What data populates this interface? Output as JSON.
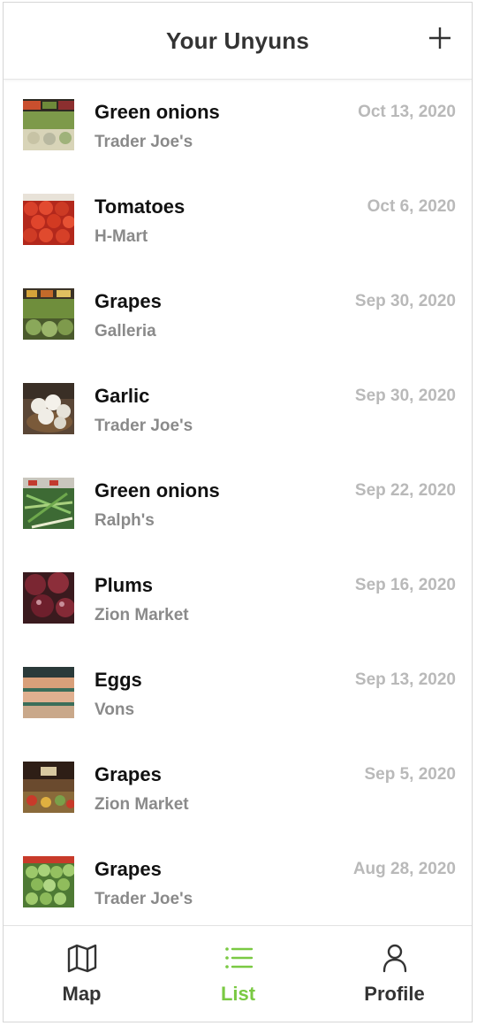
{
  "header": {
    "title": "Your Unyuns",
    "add_icon": "plus-icon"
  },
  "items": [
    {
      "name": "Green onions",
      "store": "Trader Joe's",
      "date": "Oct 13, 2020",
      "photo": "green-onions-produce-photo"
    },
    {
      "name": "Tomatoes",
      "store": "H-Mart",
      "date": "Oct 6, 2020",
      "photo": "tomatoes-photo"
    },
    {
      "name": "Grapes",
      "store": "Galleria",
      "date": "Sep 30, 2020",
      "photo": "produce-stand-photo"
    },
    {
      "name": "Garlic",
      "store": "Trader Joe's",
      "date": "Sep 30, 2020",
      "photo": "garlic-basket-photo"
    },
    {
      "name": "Green onions",
      "store": "Ralph's",
      "date": "Sep 22, 2020",
      "photo": "green-onions-shelf-photo"
    },
    {
      "name": "Plums",
      "store": "Zion Market",
      "date": "Sep 16, 2020",
      "photo": "plums-photo"
    },
    {
      "name": "Eggs",
      "store": "Vons",
      "date": "Sep 13, 2020",
      "photo": "eggs-aisle-photo"
    },
    {
      "name": "Grapes",
      "store": "Zion Market",
      "date": "Sep 5, 2020",
      "photo": "market-interior-photo"
    },
    {
      "name": "Grapes",
      "store": "Trader Joe's",
      "date": "Aug 28, 2020",
      "photo": "green-grapes-photo"
    }
  ],
  "tabs": [
    {
      "label": "Map",
      "icon": "map-icon",
      "active": false
    },
    {
      "label": "List",
      "icon": "list-icon",
      "active": true
    },
    {
      "label": "Profile",
      "icon": "person-icon",
      "active": false
    }
  ],
  "colors": {
    "accent": "#7ac943",
    "title": "#333333",
    "item_name": "#111111",
    "store": "#8a8a8a",
    "date": "#b9b9b9"
  }
}
